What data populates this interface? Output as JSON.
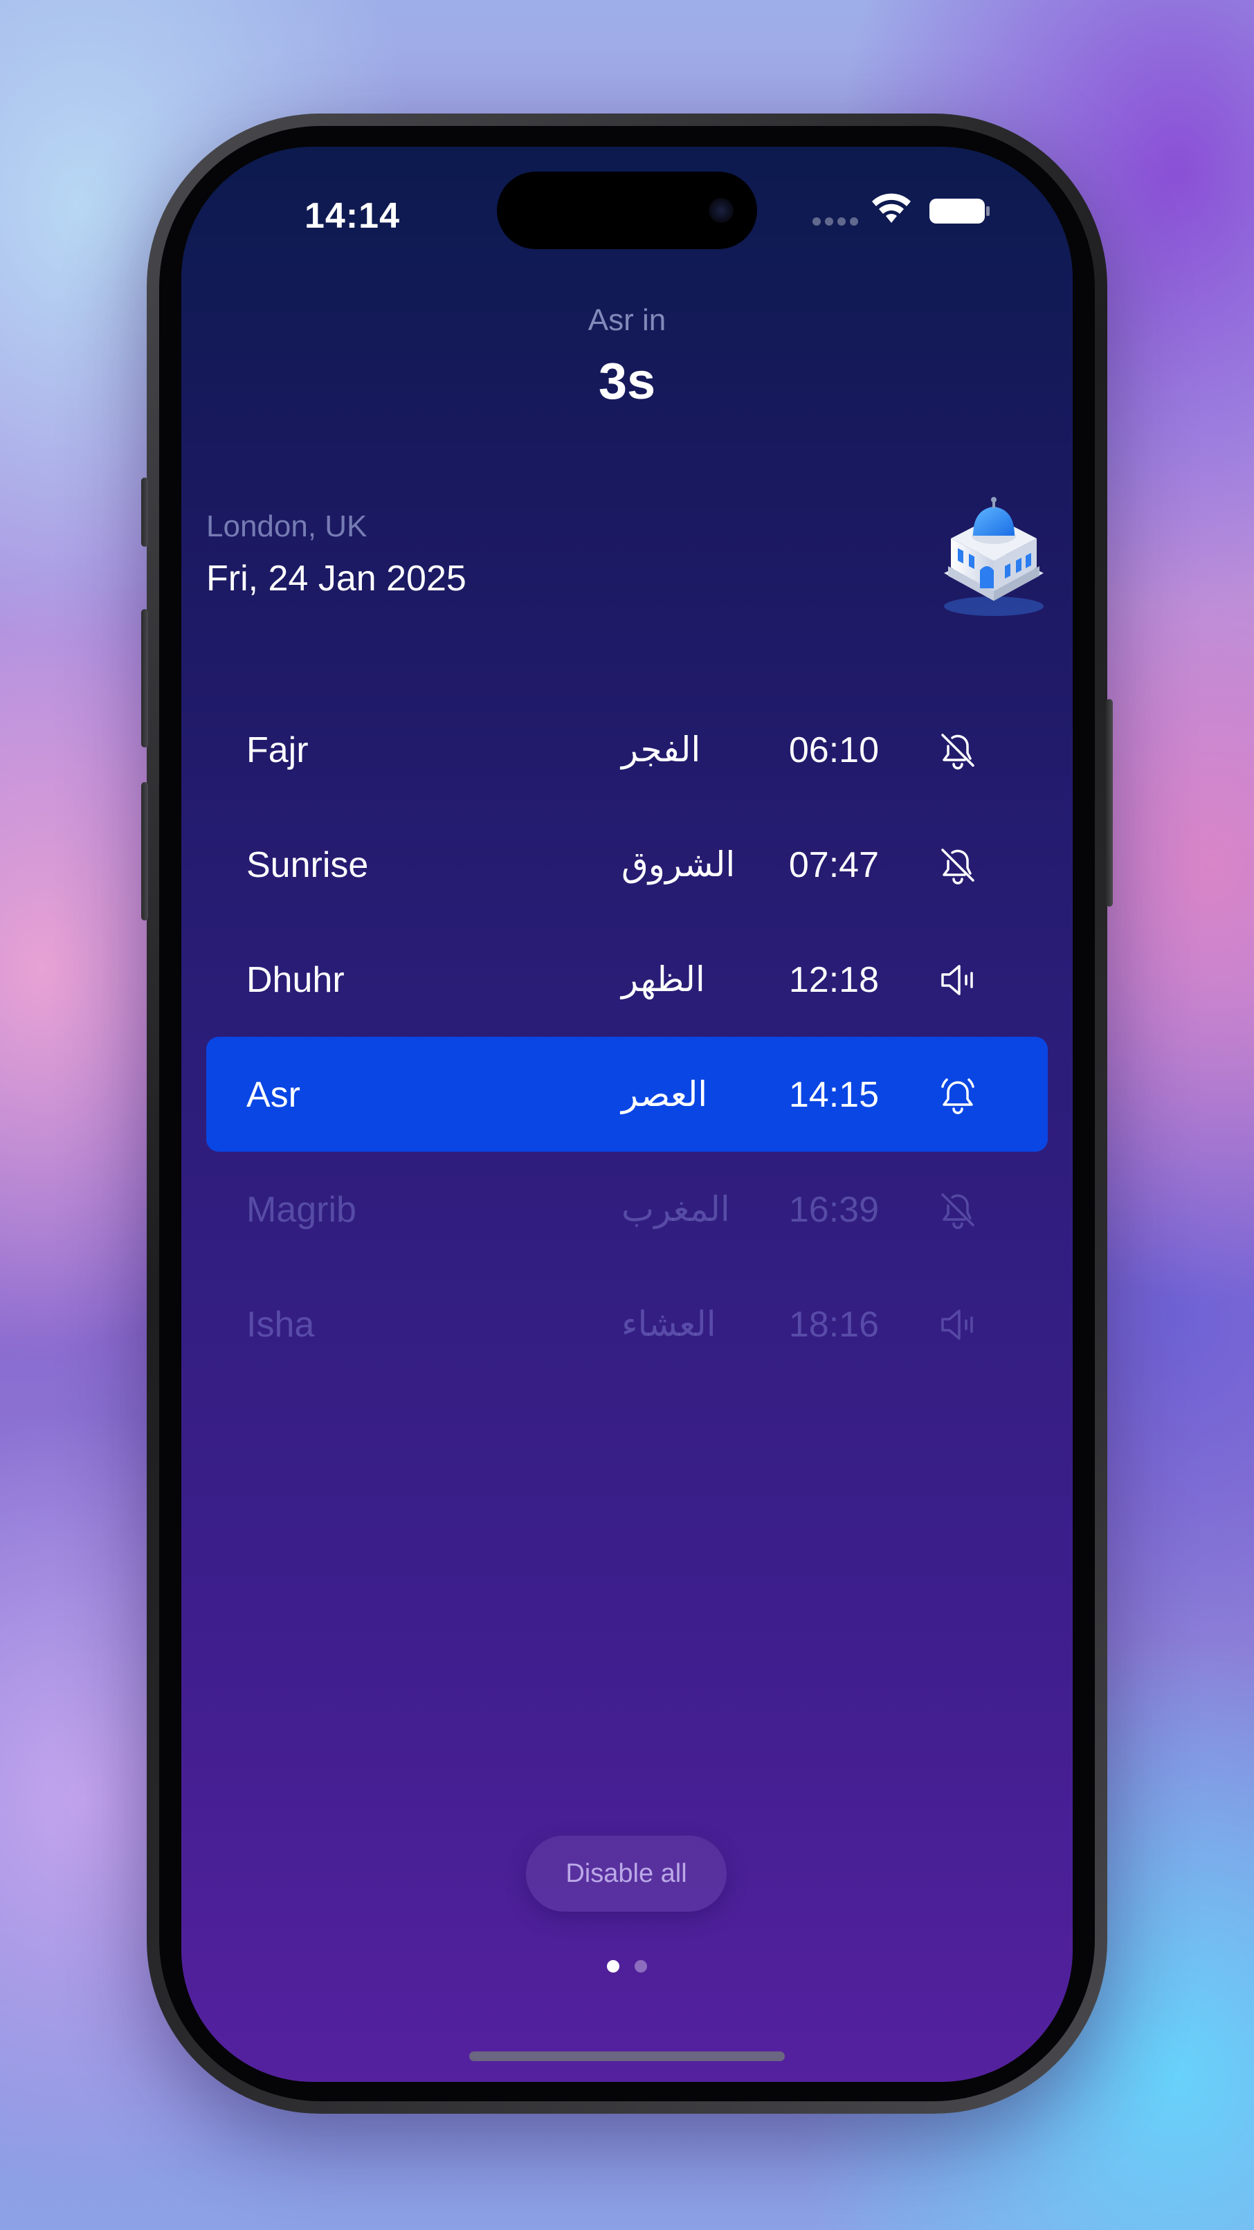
{
  "status_bar": {
    "time": "14:14",
    "icons": [
      "signal-dots-icon",
      "wifi-icon",
      "battery-icon"
    ]
  },
  "countdown": {
    "label": "Asr in",
    "value": "3s"
  },
  "location": {
    "city": "London, UK",
    "date": "Fri, 24 Jan 2025",
    "icon": "mosque-icon"
  },
  "prayers": [
    {
      "name": "Fajr",
      "arabic": "الفجر",
      "time": "06:10",
      "icon": "bell-off-icon",
      "state": "past"
    },
    {
      "name": "Sunrise",
      "arabic": "الشروق",
      "time": "07:47",
      "icon": "bell-off-icon",
      "state": "past"
    },
    {
      "name": "Dhuhr",
      "arabic": "الظهر",
      "time": "12:18",
      "icon": "speaker-icon",
      "state": "past"
    },
    {
      "name": "Asr",
      "arabic": "العصر",
      "time": "14:15",
      "icon": "bell-icon",
      "state": "active"
    },
    {
      "name": "Magrib",
      "arabic": "المغرب",
      "time": "16:39",
      "icon": "bell-off-icon",
      "state": "upcoming"
    },
    {
      "name": "Isha",
      "arabic": "العشاء",
      "time": "18:16",
      "icon": "speaker-icon",
      "state": "upcoming"
    }
  ],
  "actions": {
    "disable_all": "Disable all"
  },
  "pagination": {
    "current": 1,
    "total": 2
  },
  "colors": {
    "active_row": "#0a46e4",
    "background_top": "#0c1a4e",
    "background_bottom": "#55219f"
  }
}
